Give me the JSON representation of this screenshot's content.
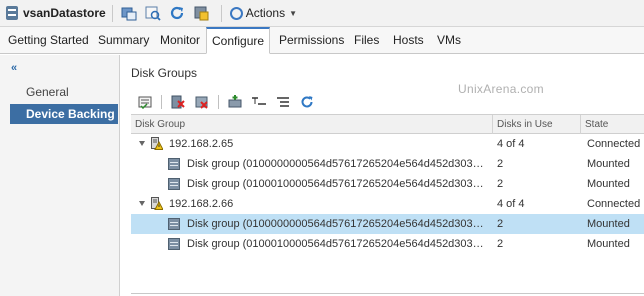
{
  "header": {
    "title": "vsanDatastore",
    "actions_label": "Actions",
    "icons": [
      "new-vm-icon",
      "browse-files-icon",
      "refresh-icon",
      "register-vm-icon",
      "actions-gear-icon"
    ]
  },
  "tabs": [
    {
      "label": "Getting Started"
    },
    {
      "label": "Summary"
    },
    {
      "label": "Monitor"
    },
    {
      "label": "Configure"
    },
    {
      "label": "Permissions"
    },
    {
      "label": "Files"
    },
    {
      "label": "Hosts"
    },
    {
      "label": "VMs"
    }
  ],
  "leftnav": {
    "collapse_glyph": "«",
    "items": [
      {
        "label": "General"
      },
      {
        "label": "Device Backing"
      }
    ]
  },
  "main": {
    "section_title": "Disk Groups",
    "watermark": "UnixArena.com",
    "columns": [
      "Disk Group",
      "Disks in Use",
      "State"
    ],
    "rows": [
      {
        "type": "host",
        "name": "192.168.2.65",
        "disks": "4 of 4",
        "state": "Connected"
      },
      {
        "type": "group",
        "name": "Disk group (0100000000564d57617265204e564d452d303…",
        "disks": "2",
        "state": "Mounted"
      },
      {
        "type": "group",
        "name": "Disk group (0100010000564d57617265204e564d452d303…",
        "disks": "2",
        "state": "Mounted"
      },
      {
        "type": "host",
        "name": "192.168.2.66",
        "disks": "4 of 4",
        "state": "Connected"
      },
      {
        "type": "group",
        "name": "Disk group (0100000000564d57617265204e564d452d303…",
        "disks": "2",
        "state": "Mounted",
        "selected": true
      },
      {
        "type": "group",
        "name": "Disk group (0100010000564d57617265204e564d452d303…",
        "disks": "2",
        "state": "Mounted"
      }
    ]
  },
  "colors": {
    "accent": "#3c6ea3",
    "selected_row": "#bfe0f5",
    "warning": "#f0c419"
  }
}
